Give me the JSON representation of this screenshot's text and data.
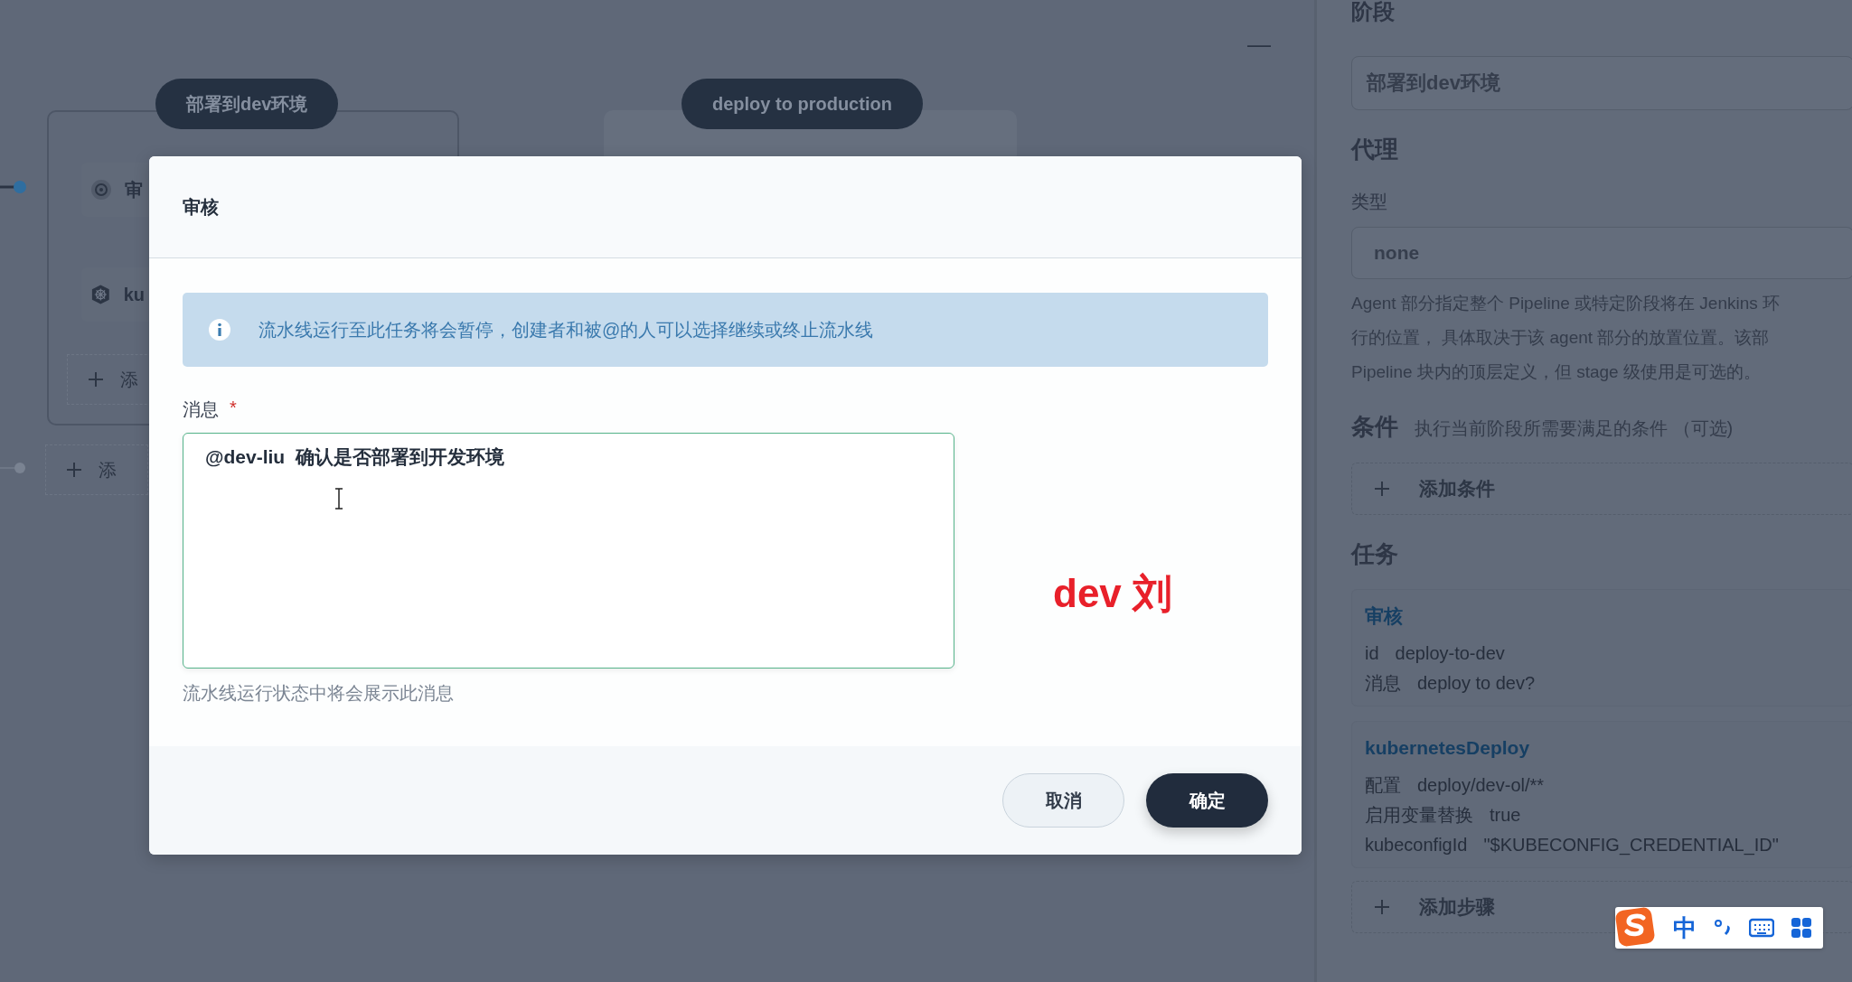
{
  "canvas": {
    "minimize": "—",
    "stages": [
      {
        "title": "部署到dev环境",
        "tasks": [
          {
            "kind": "approval",
            "label": "审"
          },
          {
            "kind": "kubernetes",
            "label": "ku"
          }
        ],
        "add_task": "添",
        "add_stage": "添"
      },
      {
        "title": "deploy to production"
      }
    ]
  },
  "side_panel": {
    "section_title": "阶段",
    "stage_name": "部署到dev环境",
    "agent_title": "代理",
    "type_label": "类型",
    "type_value": "none",
    "agent_help_lines": [
      "Agent 部分指定整个 Pipeline 或特定阶段将在 Jenkins 环",
      "行的位置， 具体取决于该 agent 部分的放置位置。该部",
      "Pipeline 块内的顶层定义，但 stage 级使用是可选的。"
    ],
    "conditions_title": "条件",
    "conditions_hint": "执行当前阶段所需要满足的条件 （可选)",
    "add_condition": "添加条件",
    "tasks_title": "任务",
    "tasks": [
      {
        "title": "审核",
        "fields": [
          {
            "key": "id",
            "value": "deploy-to-dev"
          },
          {
            "key": "消息",
            "value": "deploy to dev?"
          }
        ]
      },
      {
        "title": "kubernetesDeploy",
        "fields": [
          {
            "key": "配置",
            "value": "deploy/dev-ol/**"
          },
          {
            "key": "启用变量替换",
            "value": "true"
          },
          {
            "key": "kubeconfigId",
            "value": "\"$KUBECONFIG_CREDENTIAL_ID\""
          }
        ]
      }
    ],
    "add_step": "添加步骤"
  },
  "dialog": {
    "title": "审核",
    "notice": "流水线运行至此任务将会暂停，创建者和被@的人可以选择继续或终止流水线",
    "field_label": "消息",
    "required_mark": "*",
    "value": "@dev-liu  确认是否部署到开发环境",
    "help": "流水线运行状态中将会展示此消息",
    "buttons": [
      {
        "label": "取消",
        "kind": "secondary"
      },
      {
        "label": "确定",
        "kind": "primary"
      }
    ]
  },
  "annotation": "dev 刘",
  "ime_bar": {
    "mode": "中"
  }
}
